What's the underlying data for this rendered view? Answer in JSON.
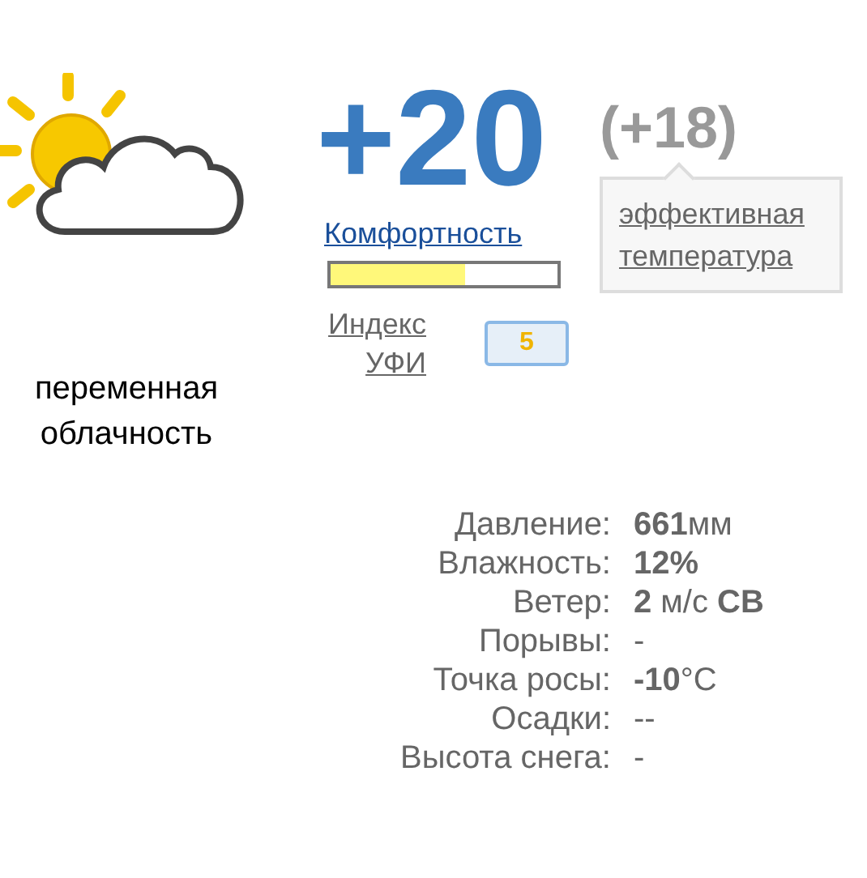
{
  "weather": {
    "condition": "переменная облачность"
  },
  "temperature": "+20",
  "feels_like": {
    "value": "(+18)",
    "tooltip": "эффективная температура"
  },
  "comfort": {
    "label": "Комфортность",
    "level": 0.59
  },
  "uv": {
    "label": "Индекс УФИ",
    "value": "5"
  },
  "details": [
    {
      "name": "Давление:",
      "reading": "**661**мм"
    },
    {
      "name": "Влажность:",
      "reading": "**12%**"
    },
    {
      "name": "Ветер:",
      "reading": "**2** м/с **СВ**"
    },
    {
      "name": "Порывы:",
      "reading": "-"
    },
    {
      "name": "Точка росы:",
      "reading": "**-10**°C"
    },
    {
      "name": "Осадки:",
      "reading": "--"
    },
    {
      "name": "Высота снега:",
      "reading": "-"
    }
  ]
}
